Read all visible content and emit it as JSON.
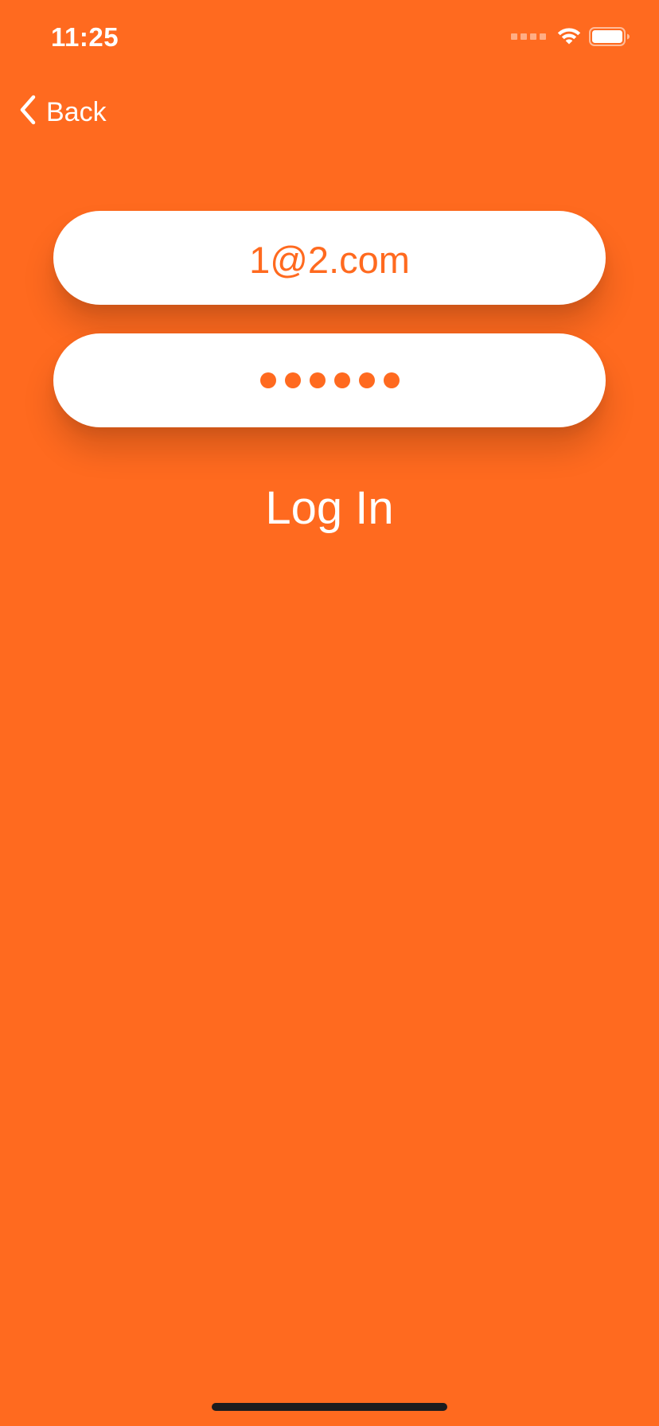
{
  "status_bar": {
    "time": "11:25"
  },
  "nav": {
    "back_label": "Back"
  },
  "form": {
    "email_value": "1@2.com",
    "password_mask_length": 6
  },
  "actions": {
    "login_label": "Log In"
  },
  "colors": {
    "background": "#FF6A1F",
    "field_background": "#FFFFFF",
    "field_text": "#FF6A1F",
    "primary_text": "#FFFFFF"
  },
  "icons": [
    "signal-icon",
    "wifi-icon",
    "battery-icon",
    "chevron-left-icon"
  ]
}
